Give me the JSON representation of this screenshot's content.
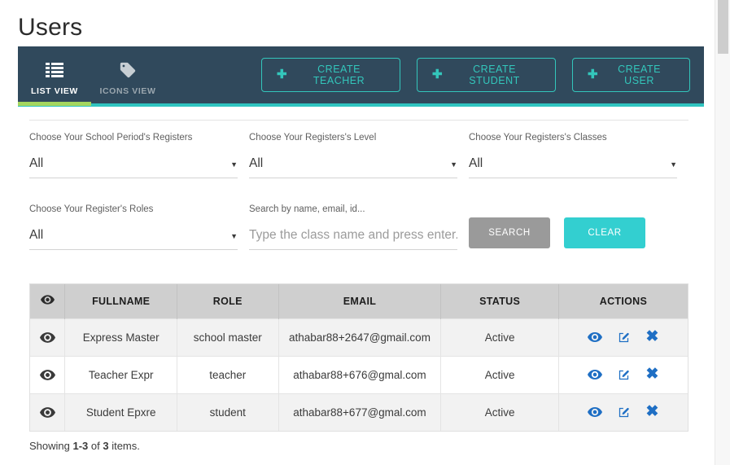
{
  "page": {
    "title": "Users"
  },
  "toolbar": {
    "tabs": [
      {
        "label": "LIST VIEW",
        "icon": "list-icon",
        "active": true
      },
      {
        "label": "ICONS VIEW",
        "icon": "tag-icon",
        "active": false
      }
    ],
    "buttons": [
      {
        "label": "CREATE TEACHER",
        "icon": "plus-icon"
      },
      {
        "label": "CREATE STUDENT",
        "icon": "plus-icon"
      },
      {
        "label": "CREATE USER",
        "icon": "plus-icon"
      }
    ],
    "plus_glyph": "✚",
    "accent_color": "#33c6bb",
    "background_color": "#30495c",
    "active_tab_underline_color": "#a4d65e",
    "underline_color": "#2fc4c0"
  },
  "filters": {
    "period": {
      "label": "Choose Your School Period's Registers",
      "value": "All",
      "caret": "▼"
    },
    "level": {
      "label": "Choose Your Registers's Level",
      "value": "All",
      "caret": "▼"
    },
    "classes": {
      "label": "Choose Your Registers's Classes",
      "value": "All",
      "caret": "▼"
    },
    "roles": {
      "label": "Choose Your Register's Roles",
      "value": "All",
      "caret": "▼"
    },
    "search": {
      "label": "Search by name, email, id...",
      "value": "",
      "placeholder": "Type the class name and press enter..."
    },
    "search_button": "SEARCH",
    "clear_button": "CLEAR",
    "search_button_color": "#9a9a9a",
    "clear_button_color": "#33cfd0"
  },
  "table": {
    "columns": [
      {
        "key": "eye",
        "label": "",
        "icon": "eye-icon"
      },
      {
        "key": "fullname",
        "label": "FULLNAME"
      },
      {
        "key": "role",
        "label": "ROLE"
      },
      {
        "key": "email",
        "label": "EMAIL"
      },
      {
        "key": "status",
        "label": "STATUS"
      },
      {
        "key": "actions",
        "label": "ACTIONS"
      }
    ],
    "rows": [
      {
        "fullname": "Express Master",
        "role": "school master",
        "email": "athabar88+2647@gmail.com",
        "status": "Active"
      },
      {
        "fullname": "Teacher Expr",
        "role": "teacher",
        "email": "athabar88+676@gmal.com",
        "status": "Active"
      },
      {
        "fullname": "Student Epxre",
        "role": "student",
        "email": "athabar88+677@gmal.com",
        "status": "Active"
      }
    ],
    "row_actions": [
      {
        "name": "view-icon",
        "title": "View"
      },
      {
        "name": "edit-icon",
        "title": "Edit"
      },
      {
        "name": "delete-icon",
        "title": "Delete",
        "glyph": "✖"
      }
    ],
    "action_icon_color": "#1f6fc4",
    "header_background": "#cfcfcf"
  },
  "footer": {
    "prefix": "Showing ",
    "range": "1-3",
    "middle": " of ",
    "total": "3",
    "suffix": " items."
  }
}
